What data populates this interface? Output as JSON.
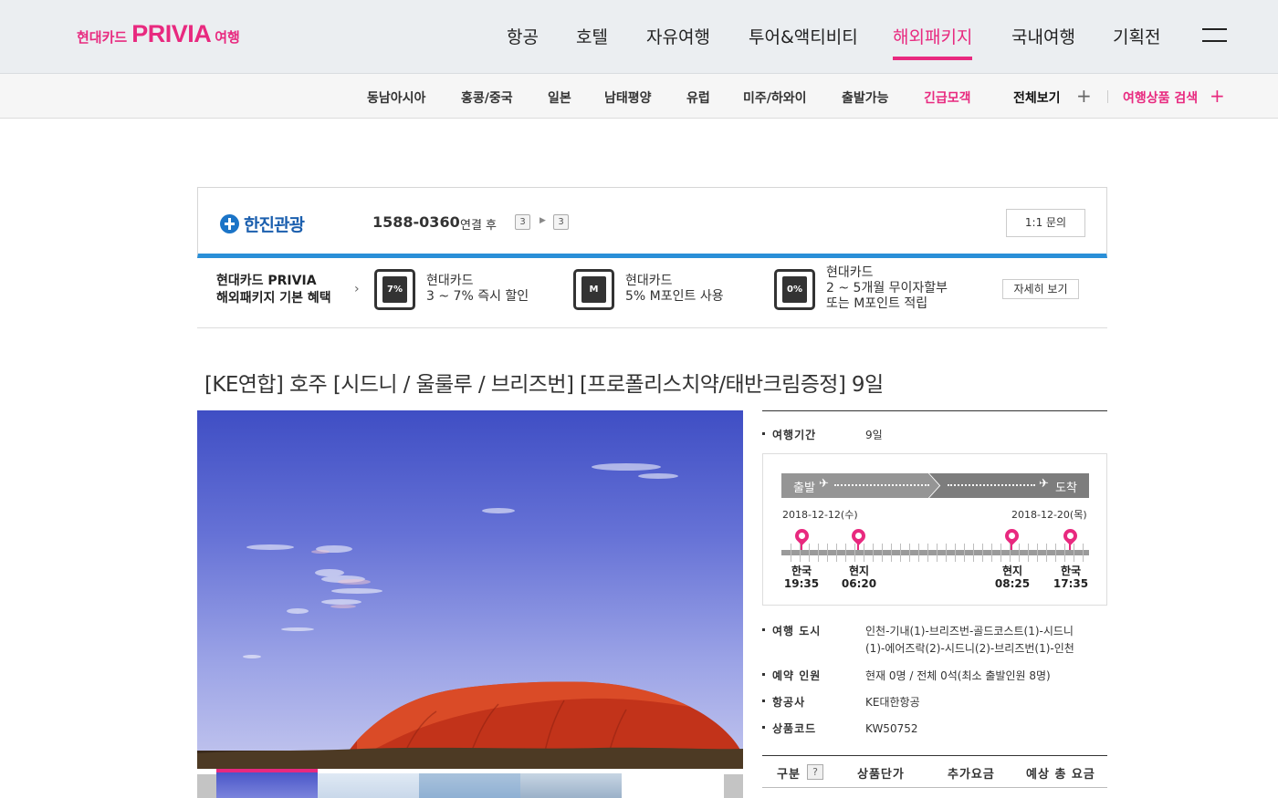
{
  "header": {
    "logo_prefix": "현대카드",
    "logo_brand": "PRIVIA",
    "logo_suffix": "여행",
    "nav": [
      "항공",
      "호텔",
      "자유여행",
      "투어&액티비티",
      "해외패키지",
      "국내여행",
      "기획전"
    ],
    "active_nav": "해외패키지"
  },
  "subnav": {
    "items": [
      "동남아시아",
      "홍콩/중국",
      "일본",
      "남태평양",
      "유럽",
      "미주/하와이",
      "출발가능",
      "긴급모객"
    ],
    "view_all": "전체보기",
    "search": "여행상품 검색"
  },
  "partner": {
    "name": "한진관광",
    "phone": "1588-0360",
    "after_text": "연결 후",
    "key1": "3",
    "key2": "3",
    "inquiry_label": "1:1 문의"
  },
  "benefits": {
    "title_line1": "현대카드 PRIVIA",
    "title_line2": "해외패키지 기본 혜택",
    "items": [
      {
        "icon": "discount-7pct-icon",
        "icon_text": "7%",
        "line1": "현대카드",
        "line2": "3 ~ 7% 즉시 할인",
        "line3": ""
      },
      {
        "icon": "m-point-icon",
        "icon_text": "M",
        "line1": "현대카드",
        "line2": "5% M포인트 사용",
        "line3": ""
      },
      {
        "icon": "zero-interest-icon",
        "icon_text": "0%",
        "line1": "현대카드",
        "line2": "2 ~ 5개월 무이자할부",
        "line3": "또는 M포인트 적립"
      }
    ],
    "detail_label": "자세히 보기"
  },
  "product": {
    "title": "[KE연합] 호주 [시드니 / 울룰루 / 브리즈번] [프로폴리스치약/태반크림증정] 9일",
    "duration_label": "여행기간",
    "duration_value": "9일",
    "timeline": {
      "depart_label": "출발",
      "arrive_label": "도착",
      "depart_date": "2018-12-12(수)",
      "arrive_date": "2018-12-20(목)",
      "stops": [
        {
          "place": "한국",
          "time": "19:35"
        },
        {
          "place": "현지",
          "time": "06:20"
        },
        {
          "place": "현지",
          "time": "08:25"
        },
        {
          "place": "한국",
          "time": "17:35"
        }
      ]
    },
    "cities_label": "여행 도시",
    "cities_line1": "인천-기내(1)-브리즈번-골드코스트(1)-시드니",
    "cities_line2": "(1)-에어즈락(2)-시드니(2)-브리즈번(1)-인천",
    "people_label": "예약 인원",
    "people_value": "현재 0명 / 전체 0석(최소 출발인원 8명)",
    "airline_label": "항공사",
    "airline_value": "KE대한항공",
    "code_label": "상품코드",
    "code_value": "KW50752"
  },
  "price_table": {
    "headers": [
      "구분",
      "상품단가",
      "추가요금",
      "예상 총 요금"
    ],
    "help": "?"
  },
  "colors": {
    "accent": "#e8297f",
    "partner_bar": "#2a8fd8"
  }
}
